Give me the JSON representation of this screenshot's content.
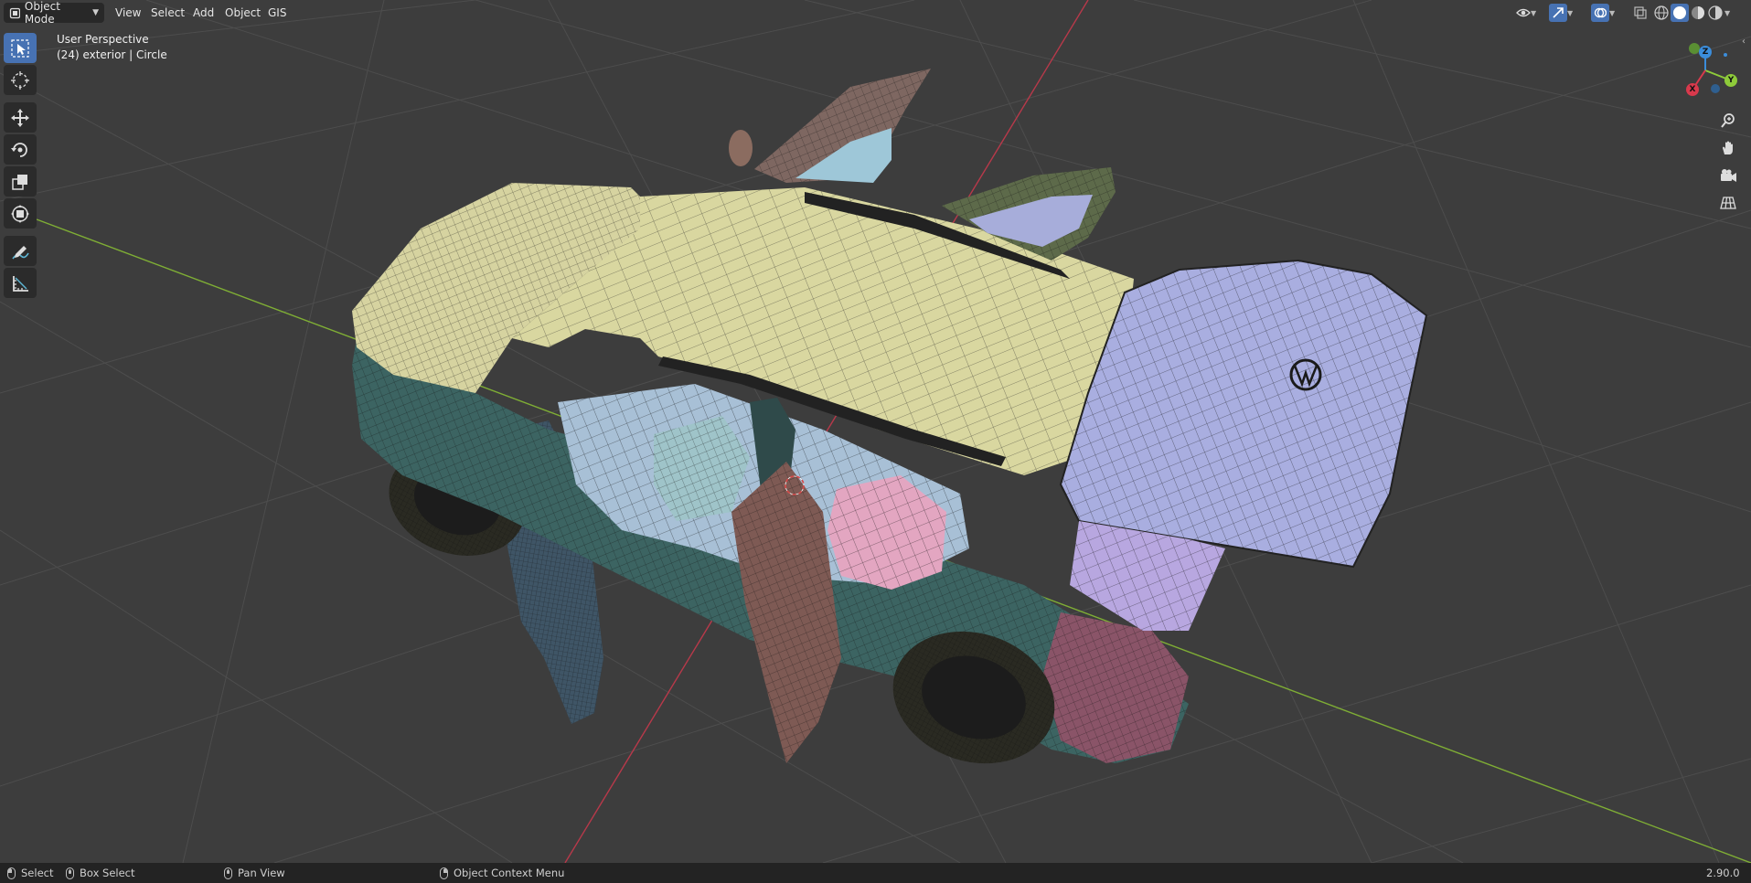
{
  "header": {
    "mode_label": "Object Mode",
    "menus": [
      "View",
      "Select",
      "Add",
      "Object",
      "GIS"
    ]
  },
  "viewport": {
    "perspective_label": "User Perspective",
    "object_label": "(24) exterior | Circle"
  },
  "toolbar": {
    "tools": [
      "select-box",
      "cursor",
      "move",
      "rotate",
      "scale",
      "transform",
      "annotate",
      "measure"
    ],
    "active_tool": "select-box"
  },
  "gizmo": {
    "axes": [
      "X",
      "Y",
      "Z"
    ]
  },
  "status": {
    "select": "Select",
    "box_select": "Box Select",
    "pan_view": "Pan View",
    "context_menu": "Object Context Menu",
    "version": "2.90.0"
  },
  "colors": {
    "accent": "#4772b3",
    "viewport_bg": "#3d3d3d",
    "x_axis": "#d8394c",
    "y_axis": "#8ecb3a",
    "z_axis": "#3b8ddb",
    "grid": "#555555",
    "roof": "#d9d7a0",
    "body": "#3d6463",
    "tailgate": "#a9afe0",
    "door_brown": "#8a5d55",
    "seat_pink": "#e8a8c4",
    "interior": "#a9c2d8"
  }
}
